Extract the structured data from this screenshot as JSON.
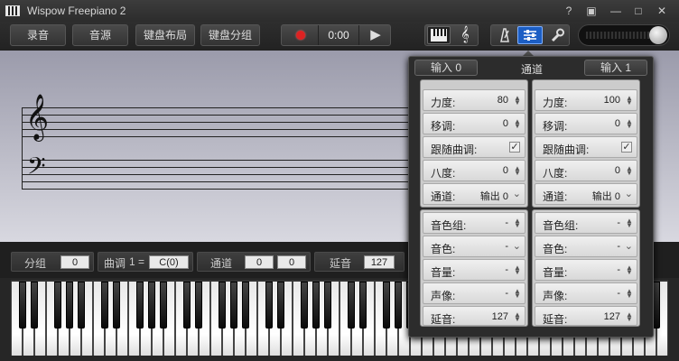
{
  "app": {
    "title": "Wispow Freepiano 2"
  },
  "window_buttons": {
    "help": "?",
    "fullscreen": "▣",
    "minimize": "—",
    "maximize": "□",
    "close": "✕"
  },
  "toolbar": {
    "record": "录音",
    "sound_source": "音源",
    "keyboard_layout": "键盘布局",
    "keyboard_groups": "键盘分组",
    "time": "0:00",
    "play": "▶",
    "view_keyboard": "𝍣",
    "view_score": "𝄞",
    "metronome": "♪",
    "mixer": "≡",
    "settings": "🔧"
  },
  "ctrlbar": {
    "group_label": "分组",
    "group_value": "0",
    "key_label": "曲调",
    "key_eq": "1 =",
    "key_value": "C(0)",
    "channel_label": "通道",
    "channel_value_1": "0",
    "channel_value_2": "0",
    "sustain_label": "延音",
    "sustain_value": "127"
  },
  "popup": {
    "input_left": "输入 0",
    "title": "通道",
    "input_right": "输入 1",
    "left": {
      "velocity_label": "力度:",
      "velocity": "80",
      "transpose_label": "移调:",
      "transpose": "0",
      "follow_label": "跟随曲调:",
      "follow": "✓",
      "octave_label": "八度:",
      "octave": "0",
      "channel_label": "通道:",
      "channel": "输出 0",
      "bank_label": "音色组:",
      "bank": "-",
      "program_label": "音色:",
      "program": "-",
      "volume_label": "音量:",
      "volume": "-",
      "pan_label": "声像:",
      "pan": "-",
      "sustain_label": "延音:",
      "sustain": "127"
    },
    "right": {
      "velocity_label": "力度:",
      "velocity": "100",
      "transpose_label": "移调:",
      "transpose": "0",
      "follow_label": "跟随曲调:",
      "follow": "✓",
      "octave_label": "八度:",
      "octave": "0",
      "channel_label": "通道:",
      "channel": "输出 0",
      "bank_label": "音色组:",
      "bank": "-",
      "program_label": "音色:",
      "program": "-",
      "volume_label": "音量:",
      "volume": "-",
      "pan_label": "声像:",
      "pan": "-",
      "sustain_label": "延音:",
      "sustain": "127"
    }
  },
  "staff": {
    "treble_clef": "𝄞",
    "bass_clef": "𝄢"
  }
}
